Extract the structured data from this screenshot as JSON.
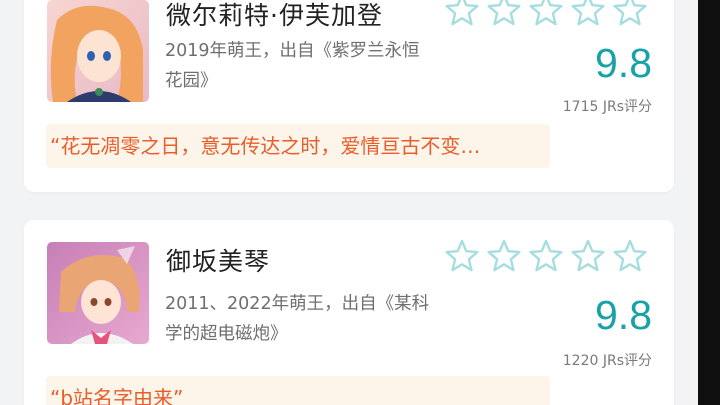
{
  "cards": [
    {
      "name": "微尔莉特·伊芙加登",
      "description": "2019年萌王，出自《紫罗兰永恒花园》",
      "score": "9.8",
      "rating_count": "1715 JRs评分",
      "quote": "“花无凋零之日，意无传达之时，爱情亘古不变…",
      "stars_filled": 0,
      "stars_total": 5
    },
    {
      "name": "御坂美琴",
      "description": "2011、2022年萌王，出自《某科学的超电磁炮》",
      "score": "9.8",
      "rating_count": "1220 JRs评分",
      "quote": "“b站名字由来”",
      "stars_filled": 0,
      "stars_total": 5
    }
  ],
  "colors": {
    "score": "#17a2a6",
    "star_outline": "#a6dde0",
    "quote_text": "#e85d2a",
    "quote_bg": "#fdf5ea"
  },
  "icons": [
    "star-outline-icon"
  ]
}
